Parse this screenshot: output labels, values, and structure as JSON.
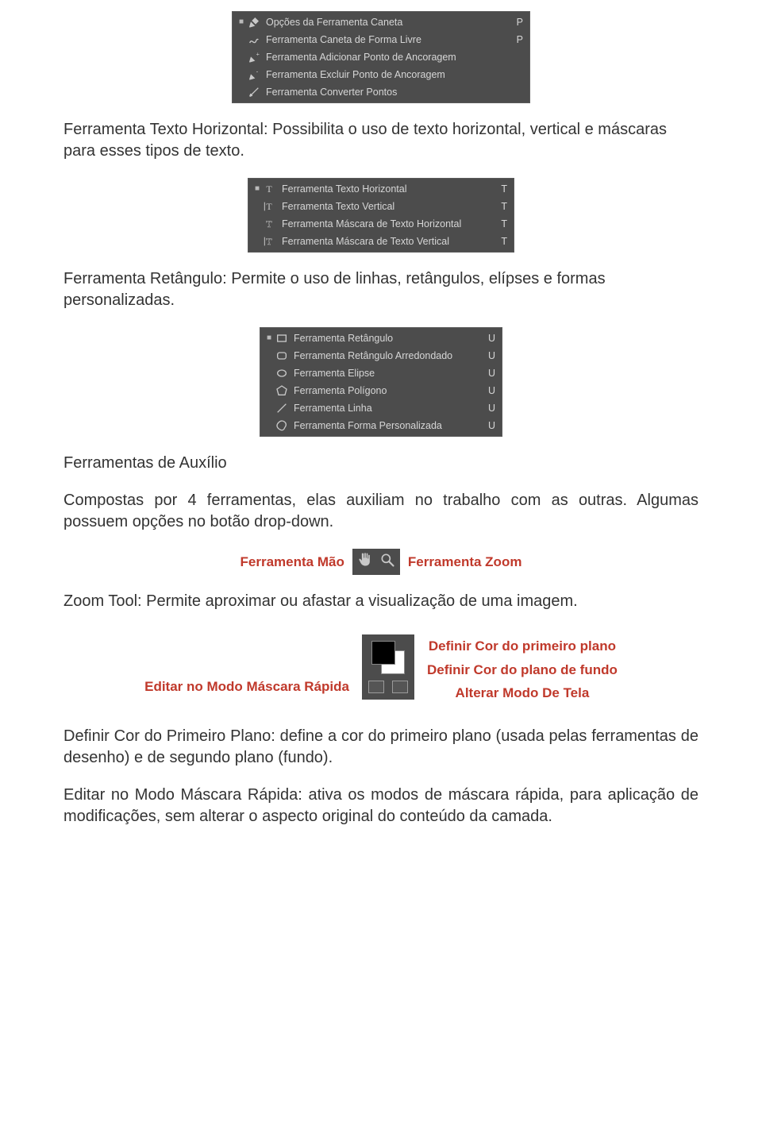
{
  "pen_menu": {
    "items": [
      {
        "label": "Opções da Ferramenta Caneta",
        "shortcut": "P",
        "bullet": true,
        "icon": "pen"
      },
      {
        "label": "Ferramenta Caneta de Forma Livre",
        "shortcut": "P",
        "bullet": false,
        "icon": "freeform"
      },
      {
        "label": "Ferramenta Adicionar Ponto de Ancoragem",
        "shortcut": "",
        "bullet": false,
        "icon": "addpoint"
      },
      {
        "label": "Ferramenta Excluir Ponto de Ancoragem",
        "shortcut": "",
        "bullet": false,
        "icon": "delpoint"
      },
      {
        "label": "Ferramenta Converter Pontos",
        "shortcut": "",
        "bullet": false,
        "icon": "convert"
      }
    ]
  },
  "para_text_horizontal": "Ferramenta Texto Horizontal: Possibilita o uso de texto horizontal, vertical e máscaras para esses tipos de texto.",
  "text_menu": {
    "items": [
      {
        "label": "Ferramenta Texto Horizontal",
        "shortcut": "T",
        "bullet": true,
        "icon": "T"
      },
      {
        "label": "Ferramenta Texto Vertical",
        "shortcut": "T",
        "bullet": false,
        "icon": "Tv"
      },
      {
        "label": "Ferramenta Máscara de Texto Horizontal",
        "shortcut": "T",
        "bullet": false,
        "icon": "Tm"
      },
      {
        "label": "Ferramenta Máscara de Texto Vertical",
        "shortcut": "T",
        "bullet": false,
        "icon": "Tvm"
      }
    ]
  },
  "para_retangulo": "Ferramenta Retângulo: Permite o uso de linhas, retângulos, elípses e formas personalizadas.",
  "shape_menu": {
    "items": [
      {
        "label": "Ferramenta Retângulo",
        "shortcut": "U",
        "bullet": true,
        "icon": "rect"
      },
      {
        "label": "Ferramenta Retângulo Arredondado",
        "shortcut": "U",
        "bullet": false,
        "icon": "roundrect"
      },
      {
        "label": "Ferramenta Elipse",
        "shortcut": "U",
        "bullet": false,
        "icon": "ellipse"
      },
      {
        "label": "Ferramenta Polígono",
        "shortcut": "U",
        "bullet": false,
        "icon": "polygon"
      },
      {
        "label": "Ferramenta Linha",
        "shortcut": "U",
        "bullet": false,
        "icon": "line"
      },
      {
        "label": "Ferramenta Forma Personalizada",
        "shortcut": "U",
        "bullet": false,
        "icon": "blob"
      }
    ]
  },
  "heading_auxilio": "Ferramentas de Auxílio",
  "para_auxilio": "Compostas por 4 ferramentas, elas auxiliam no trabalho com as outras. Algumas possuem opções no botão drop-down.",
  "hand_label": "Ferramenta Mão",
  "zoom_label": "Ferramenta Zoom",
  "para_zoom": "Zoom Tool: Permite aproximar ou afastar a visualização de uma imagem.",
  "swatch": {
    "left": "Editar no Modo Máscara Rápida",
    "right": [
      "Definir Cor do primeiro plano",
      "Definir Cor do plano de fundo",
      "Alterar Modo De Tela"
    ]
  },
  "para_definir": "Definir Cor do Primeiro Plano: define a cor do primeiro plano (usada pelas ferramentas de desenho) e de segundo plano (fundo).",
  "para_editar": "Editar no Modo Máscara Rápida: ativa os modos de máscara rápida, para aplicação de modificações, sem alterar o aspecto original do conteúdo da camada."
}
